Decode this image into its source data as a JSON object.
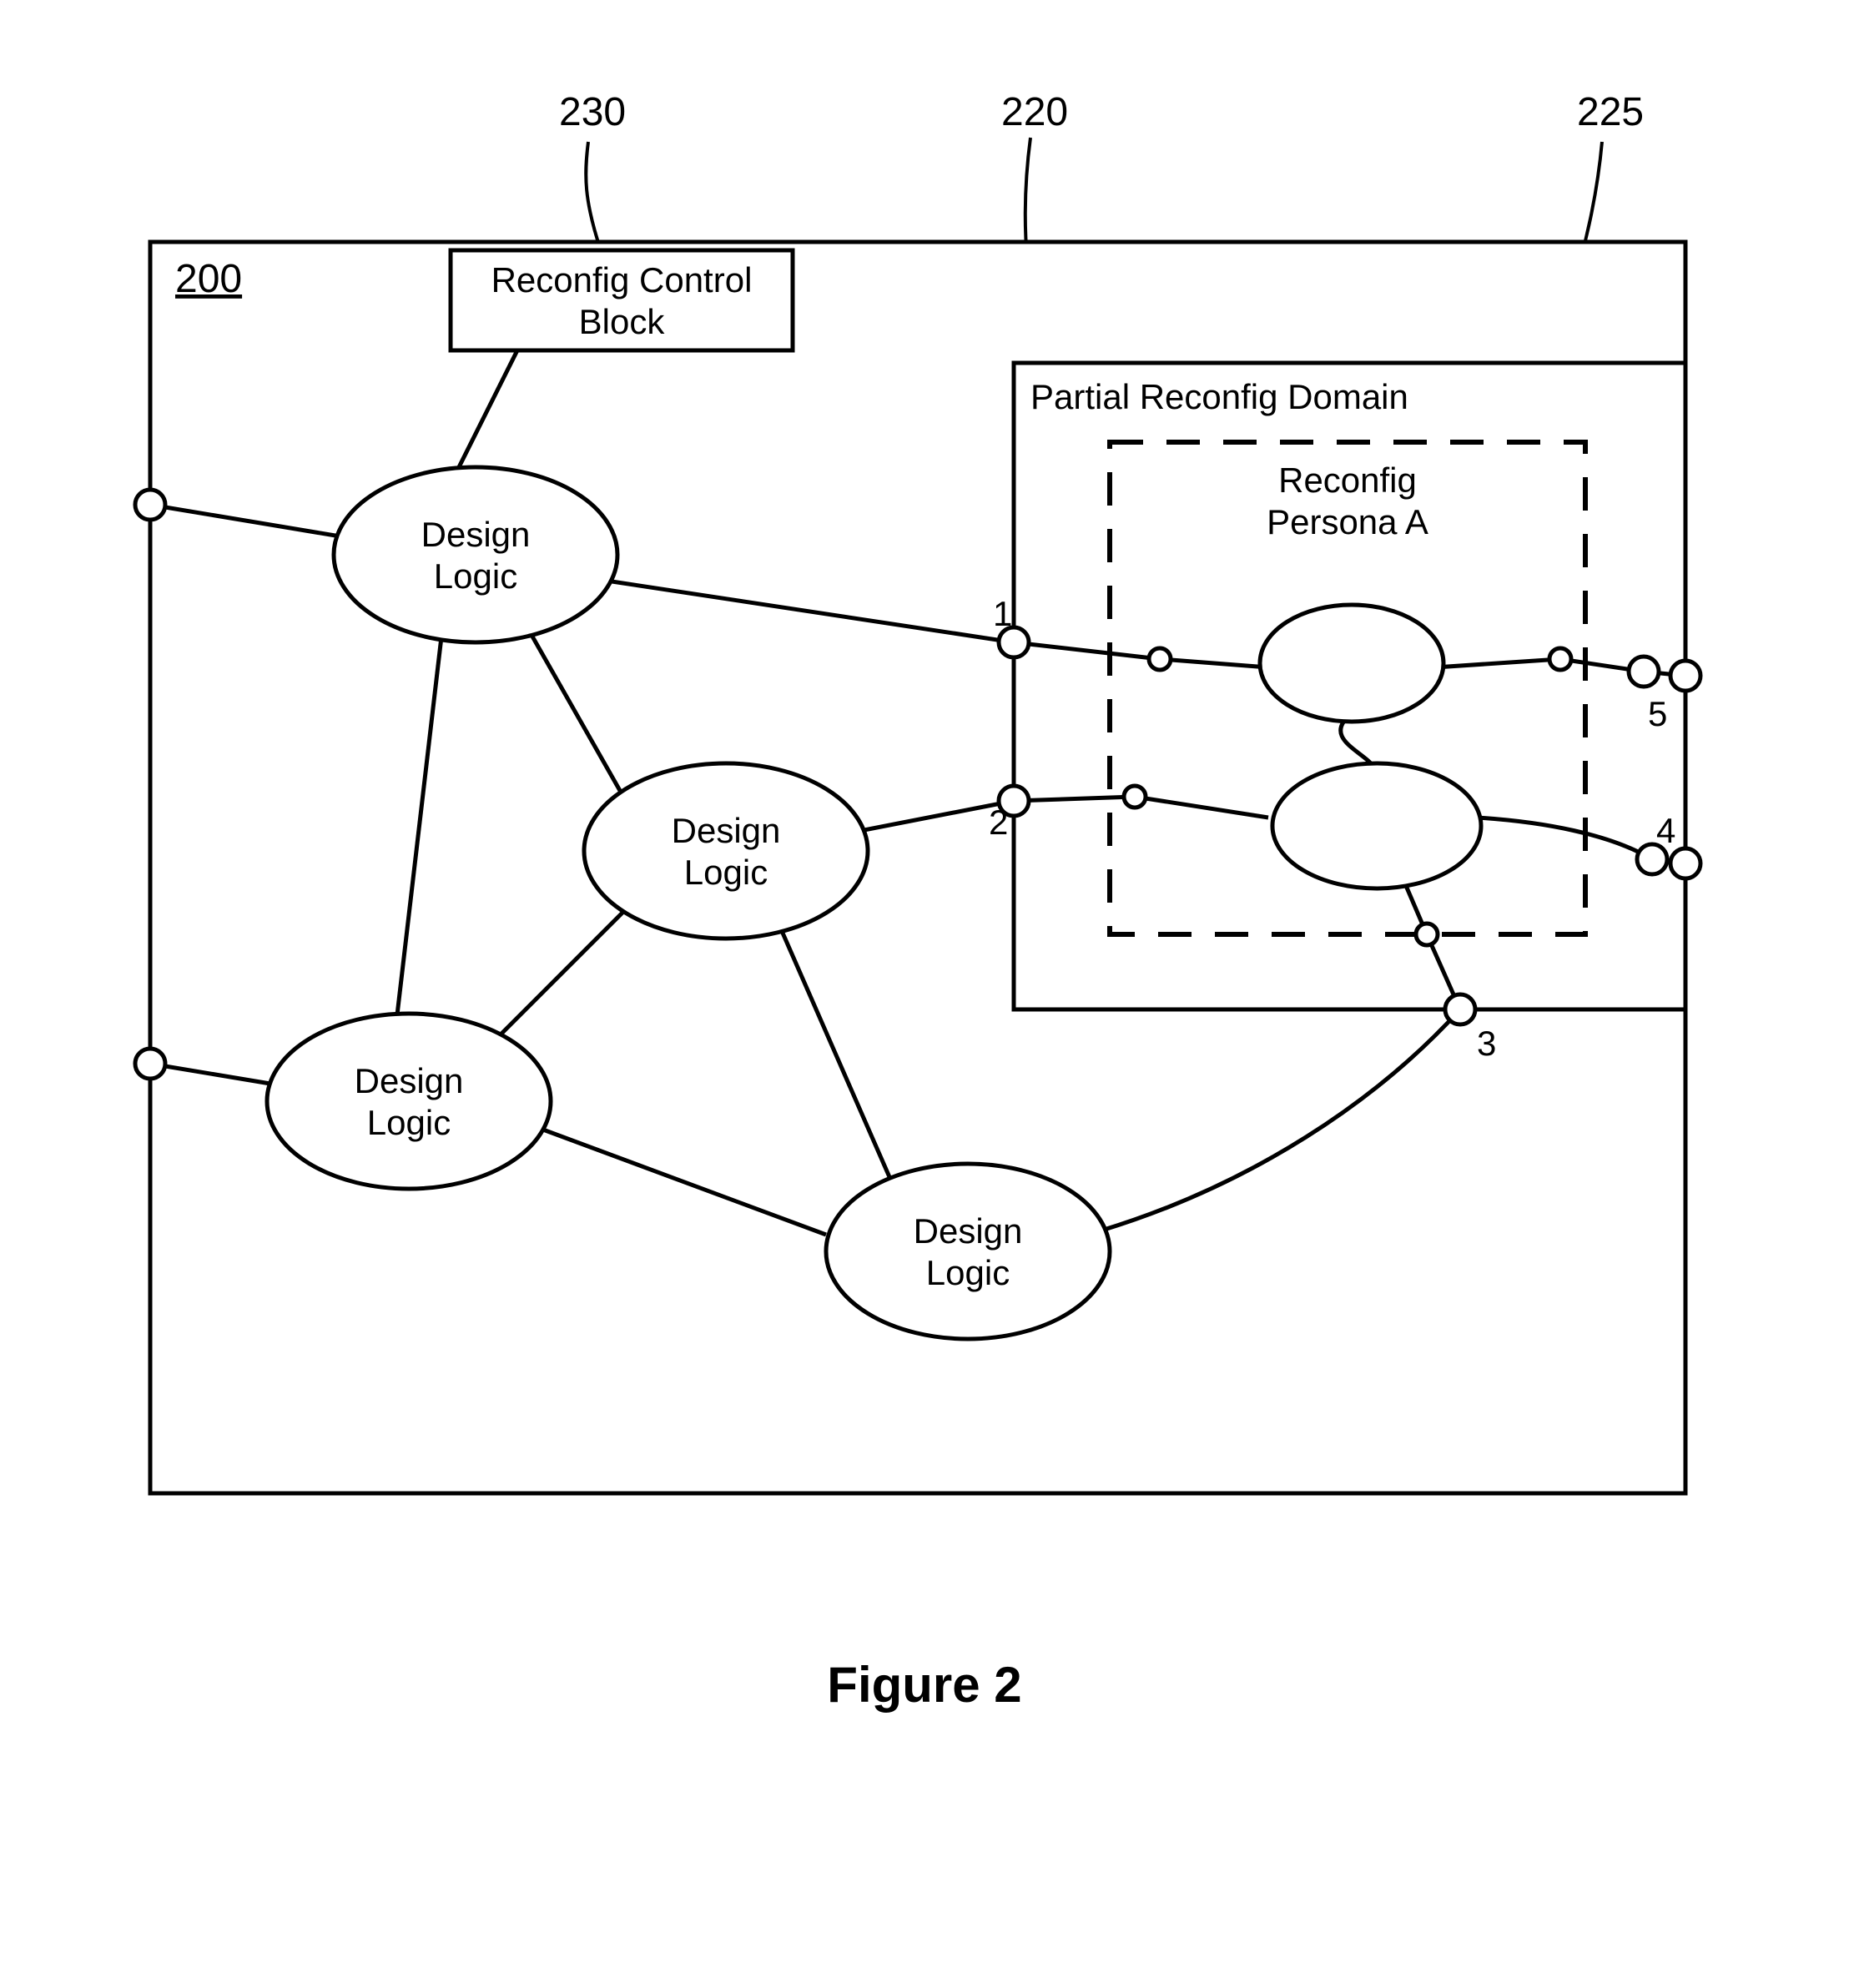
{
  "refs": {
    "r200": "200",
    "r230": "230",
    "r220": "220",
    "r225": "225"
  },
  "blocks": {
    "reconfig_control_line1": "Reconfig Control",
    "reconfig_control_line2": "Block",
    "partial_reconfig_domain": "Partial Reconfig Domain",
    "reconfig_persona_line1": "Reconfig",
    "reconfig_persona_line2": "Persona A",
    "design_logic_line1": "Design",
    "design_logic_line2": "Logic"
  },
  "port_labels": {
    "p1": "1",
    "p2": "2",
    "p3": "3",
    "p4": "4",
    "p5": "5"
  },
  "caption": "Figure 2"
}
